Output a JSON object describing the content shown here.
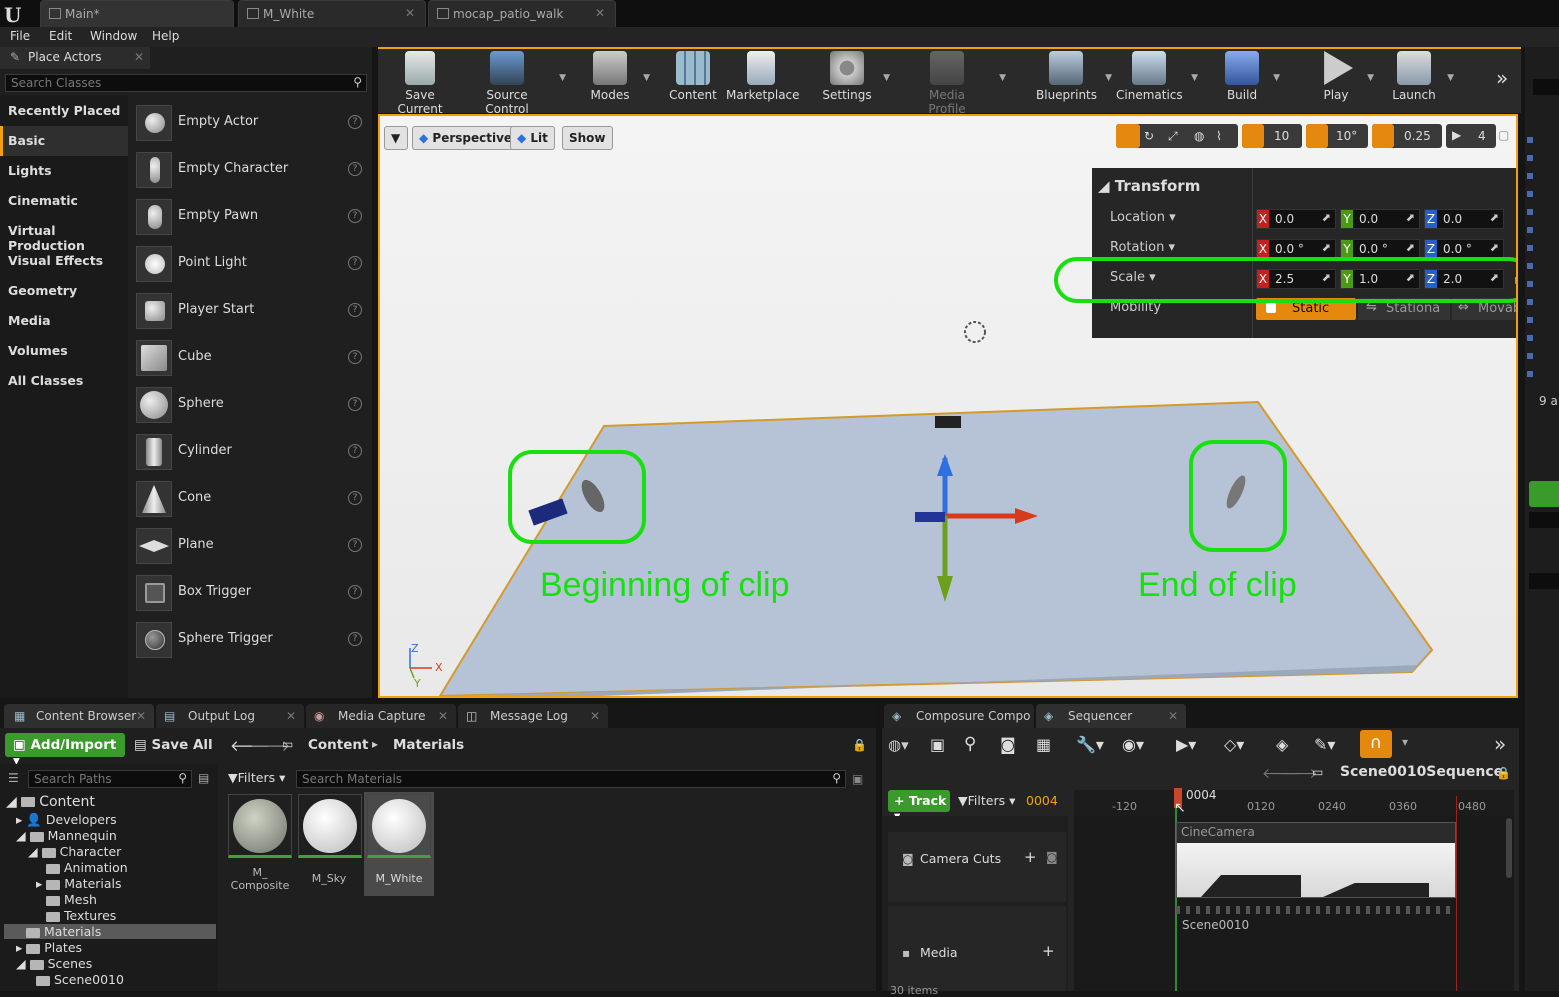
{
  "tabs": [
    {
      "label": "Main*"
    },
    {
      "label": "M_White"
    },
    {
      "label": "mocap_patio_walk"
    }
  ],
  "menu": [
    "File",
    "Edit",
    "Window",
    "Help"
  ],
  "place": {
    "title": "Place Actors",
    "search_placeholder": "Search Classes",
    "categories": [
      "Recently Placed",
      "Basic",
      "Lights",
      "Cinematic",
      "Virtual Production",
      "Visual Effects",
      "Geometry",
      "Media",
      "Volumes",
      "All Classes"
    ],
    "items": [
      "Empty Actor",
      "Empty Character",
      "Empty Pawn",
      "Point Light",
      "Player Start",
      "Cube",
      "Sphere",
      "Cylinder",
      "Cone",
      "Plane",
      "Box Trigger",
      "Sphere Trigger"
    ],
    "help": "?"
  },
  "toolbar": [
    "Save Current",
    "Source Control",
    "Modes",
    "Content",
    "Marketplace",
    "Settings",
    "Media Profile",
    "Blueprints",
    "Cinematics",
    "Build",
    "Play",
    "Launch"
  ],
  "viewport": {
    "perspective": "Perspective",
    "lit": "Lit",
    "show": "Show",
    "grid": "10",
    "angle": "10°",
    "scale": "0.25",
    "speed": "4",
    "anno_begin": "Beginning of clip",
    "anno_end": "End of clip",
    "axis_x": "X",
    "axis_y": "Y",
    "axis_z": "Z"
  },
  "transform": {
    "title": "Transform",
    "location_label": "Location",
    "rotation_label": "Rotation",
    "scale_label": "Scale",
    "mobility_label": "Mobility",
    "location": [
      "0.0",
      "0.0",
      "0.0"
    ],
    "rotation": [
      "0.0 °",
      "0.0 °",
      "0.0 °"
    ],
    "scale": [
      "2.5",
      "1.0",
      "2.0"
    ],
    "mobility": [
      "Static",
      "Stationa",
      "Movabl"
    ],
    "axes": [
      "X",
      "Y",
      "Z"
    ]
  },
  "bottom_tabs": [
    {
      "label": "Content Browser"
    },
    {
      "label": "Output Log"
    },
    {
      "label": "Media Capture"
    },
    {
      "label": "Message Log"
    }
  ],
  "seq_tabs": [
    {
      "label": "Composure Compo"
    },
    {
      "label": "Sequencer"
    }
  ],
  "cb": {
    "add": "Add/Import",
    "save": "Save All",
    "path_root": "Content",
    "path_leaf": "Materials",
    "search_paths": "Search Paths",
    "filters": "Filters",
    "search_materials": "Search Materials",
    "tree": [
      "Content",
      "Developers",
      "Mannequin",
      "Character",
      "Animation",
      "Materials",
      "Mesh",
      "Textures",
      "Materials",
      "Plates",
      "Scenes",
      "Scene0010"
    ],
    "assets": [
      "M_\nComposite",
      "M_Sky",
      "M_White"
    ]
  },
  "seq": {
    "name": "Scene0010Sequence",
    "track": "Track",
    "filters": "Filters",
    "frame": "0004",
    "time": "0004",
    "ticks": [
      "-120",
      "0120",
      "0240",
      "0360",
      "0480"
    ],
    "camera_cuts": "Camera Cuts",
    "media": "Media",
    "cine": "CineCamera",
    "scene": "Scene0010",
    "items": "30 items"
  },
  "right": {
    "count": "9 a"
  }
}
